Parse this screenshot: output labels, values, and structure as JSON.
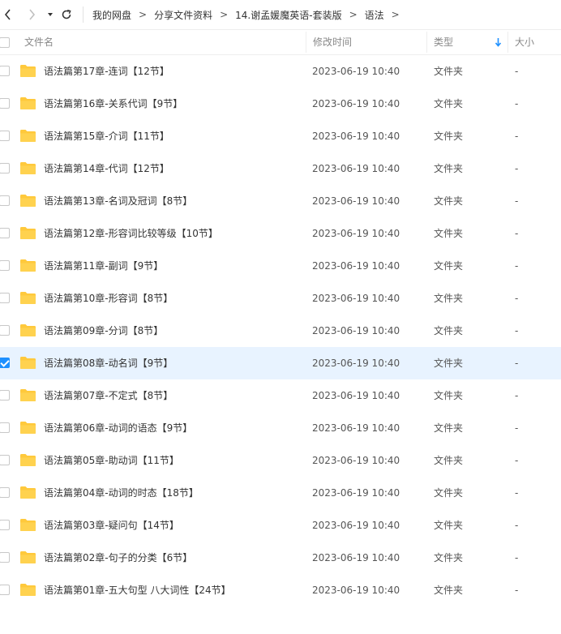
{
  "breadcrumb": [
    "我的网盘",
    "分享文件资料",
    "14.谢孟媛魔英语-套装版",
    "语法"
  ],
  "breadcrumb_separator": ">",
  "columns": {
    "name": "文件名",
    "modified": "修改时间",
    "type": "类型",
    "size": "大小"
  },
  "sort": {
    "column": "type",
    "direction": "down",
    "indicator_color": "#1e90ff"
  },
  "colors": {
    "folder": "#ffc93c",
    "selected_row": "#e8f3ff",
    "accent": "#1e90ff"
  },
  "files": [
    {
      "name": "语法篇第17章-连词【12节】",
      "modified": "2023-06-19 10:40",
      "type": "文件夹",
      "size": "-",
      "selected": false
    },
    {
      "name": "语法篇第16章-关系代词【9节】",
      "modified": "2023-06-19 10:40",
      "type": "文件夹",
      "size": "-",
      "selected": false
    },
    {
      "name": "语法篇第15章-介词【11节】",
      "modified": "2023-06-19 10:40",
      "type": "文件夹",
      "size": "-",
      "selected": false
    },
    {
      "name": "语法篇第14章-代词【12节】",
      "modified": "2023-06-19 10:40",
      "type": "文件夹",
      "size": "-",
      "selected": false
    },
    {
      "name": "语法篇第13章-名词及冠词【8节】",
      "modified": "2023-06-19 10:40",
      "type": "文件夹",
      "size": "-",
      "selected": false
    },
    {
      "name": "语法篇第12章-形容词比较等级【10节】",
      "modified": "2023-06-19 10:40",
      "type": "文件夹",
      "size": "-",
      "selected": false
    },
    {
      "name": "语法篇第11章-副词【9节】",
      "modified": "2023-06-19 10:40",
      "type": "文件夹",
      "size": "-",
      "selected": false
    },
    {
      "name": "语法篇第10章-形容词【8节】",
      "modified": "2023-06-19 10:40",
      "type": "文件夹",
      "size": "-",
      "selected": false
    },
    {
      "name": "语法篇第09章-分词【8节】",
      "modified": "2023-06-19 10:40",
      "type": "文件夹",
      "size": "-",
      "selected": false
    },
    {
      "name": "语法篇第08章-动名词【9节】",
      "modified": "2023-06-19 10:40",
      "type": "文件夹",
      "size": "-",
      "selected": true
    },
    {
      "name": "语法篇第07章-不定式【8节】",
      "modified": "2023-06-19 10:40",
      "type": "文件夹",
      "size": "-",
      "selected": false
    },
    {
      "name": "语法篇第06章-动词的语态【9节】",
      "modified": "2023-06-19 10:40",
      "type": "文件夹",
      "size": "-",
      "selected": false
    },
    {
      "name": "语法篇第05章-助动词【11节】",
      "modified": "2023-06-19 10:40",
      "type": "文件夹",
      "size": "-",
      "selected": false
    },
    {
      "name": "语法篇第04章-动词的时态【18节】",
      "modified": "2023-06-19 10:40",
      "type": "文件夹",
      "size": "-",
      "selected": false
    },
    {
      "name": "语法篇第03章-疑问句【14节】",
      "modified": "2023-06-19 10:40",
      "type": "文件夹",
      "size": "-",
      "selected": false
    },
    {
      "name": "语法篇第02章-句子的分类【6节】",
      "modified": "2023-06-19 10:40",
      "type": "文件夹",
      "size": "-",
      "selected": false
    },
    {
      "name": "语法篇第01章-五大句型 八大词性【24节】",
      "modified": "2023-06-19 10:40",
      "type": "文件夹",
      "size": "-",
      "selected": false
    }
  ]
}
